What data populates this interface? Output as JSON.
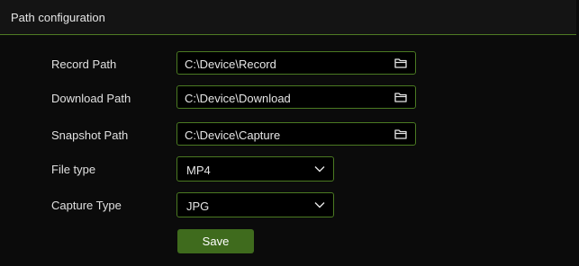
{
  "header": {
    "title": "Path configuration"
  },
  "form": {
    "record_path": {
      "label": "Record Path",
      "value": "C:\\Device\\Record",
      "icon": "folder-icon"
    },
    "download_path": {
      "label": "Download Path",
      "value": "C:\\Device\\Download",
      "icon": "folder-icon"
    },
    "snapshot_path": {
      "label": "Snapshot Path",
      "value": "C:\\Device\\Capture",
      "icon": "folder-icon"
    },
    "file_type": {
      "label": "File type",
      "value": "MP4",
      "icon": "chevron-down-icon"
    },
    "capture_type": {
      "label": "Capture Type",
      "value": "JPG",
      "icon": "chevron-down-icon"
    },
    "save_label": "Save"
  },
  "colors": {
    "accent_green": "#4b7a22",
    "button_green": "#3f6b1d",
    "background": "#0b0b0b"
  }
}
